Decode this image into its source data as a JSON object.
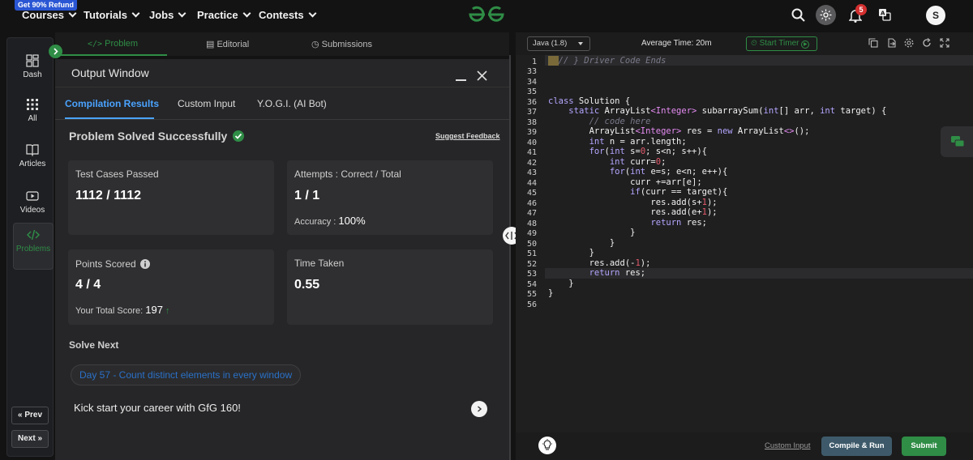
{
  "topnav": {
    "refund_badge": "Get 90% Refund",
    "items": [
      {
        "label": "Courses"
      },
      {
        "label": "Tutorials"
      },
      {
        "label": "Jobs"
      },
      {
        "label": "Practice"
      },
      {
        "label": "Contests"
      }
    ],
    "notification_count": "5",
    "avatar_initial": "S"
  },
  "sidebar": {
    "items": [
      {
        "label": "Dash",
        "icon": "dashboard-icon"
      },
      {
        "label": "All",
        "icon": "grid-icon"
      },
      {
        "label": "Articles",
        "icon": "book-icon"
      },
      {
        "label": "Videos",
        "icon": "video-icon"
      },
      {
        "label": "Problems",
        "icon": "code-icon"
      }
    ],
    "prev_label": "Prev",
    "next_label": "Next"
  },
  "left_tabs": {
    "problem": "Problem",
    "editorial": "Editorial",
    "submissions": "Submissions"
  },
  "output_window": {
    "title": "Output Window",
    "tabs": [
      "Compilation Results",
      "Custom Input",
      "Y.O.G.I. (AI Bot)"
    ],
    "status": "Problem Solved Successfully",
    "suggest_feedback": "Suggest Feedback",
    "cards": {
      "test_cases_label": "Test Cases Passed",
      "test_cases_value": "1112 / 1112",
      "attempts_label": "Attempts : Correct / Total",
      "attempts_value": "1 / 1",
      "accuracy_label": "Accuracy :",
      "accuracy_value": "100%",
      "points_label": "Points Scored",
      "points_value": "4 / 4",
      "total_score_label": "Your Total Score:",
      "total_score_value": "197",
      "time_label": "Time Taken",
      "time_value": "0.55"
    },
    "solve_next_label": "Solve Next",
    "next_problem": "Day 57 - Count distinct elements in every window",
    "promo_text": "Kick start your career with GfG 160!"
  },
  "editor": {
    "language": "Java (1.8)",
    "average_time_label": "Average Time: 20m",
    "start_timer": "Start Timer",
    "line_numbers": [
      "1",
      "33",
      "34",
      "35",
      "36",
      "37",
      "38",
      "39",
      "40",
      "41",
      "42",
      "43",
      "44",
      "45",
      "46",
      "47",
      "48",
      "49",
      "50",
      "51",
      "52",
      "53",
      "54",
      "55",
      "56"
    ],
    "custom_input": "Custom Input",
    "compile_run": "Compile & Run",
    "submit": "Submit"
  },
  "colors": {
    "accent_green": "#2f8d46",
    "tab_blue": "#4aa3ff",
    "refund_blue": "#2a56d4",
    "notification_red": "#d32f2f"
  }
}
